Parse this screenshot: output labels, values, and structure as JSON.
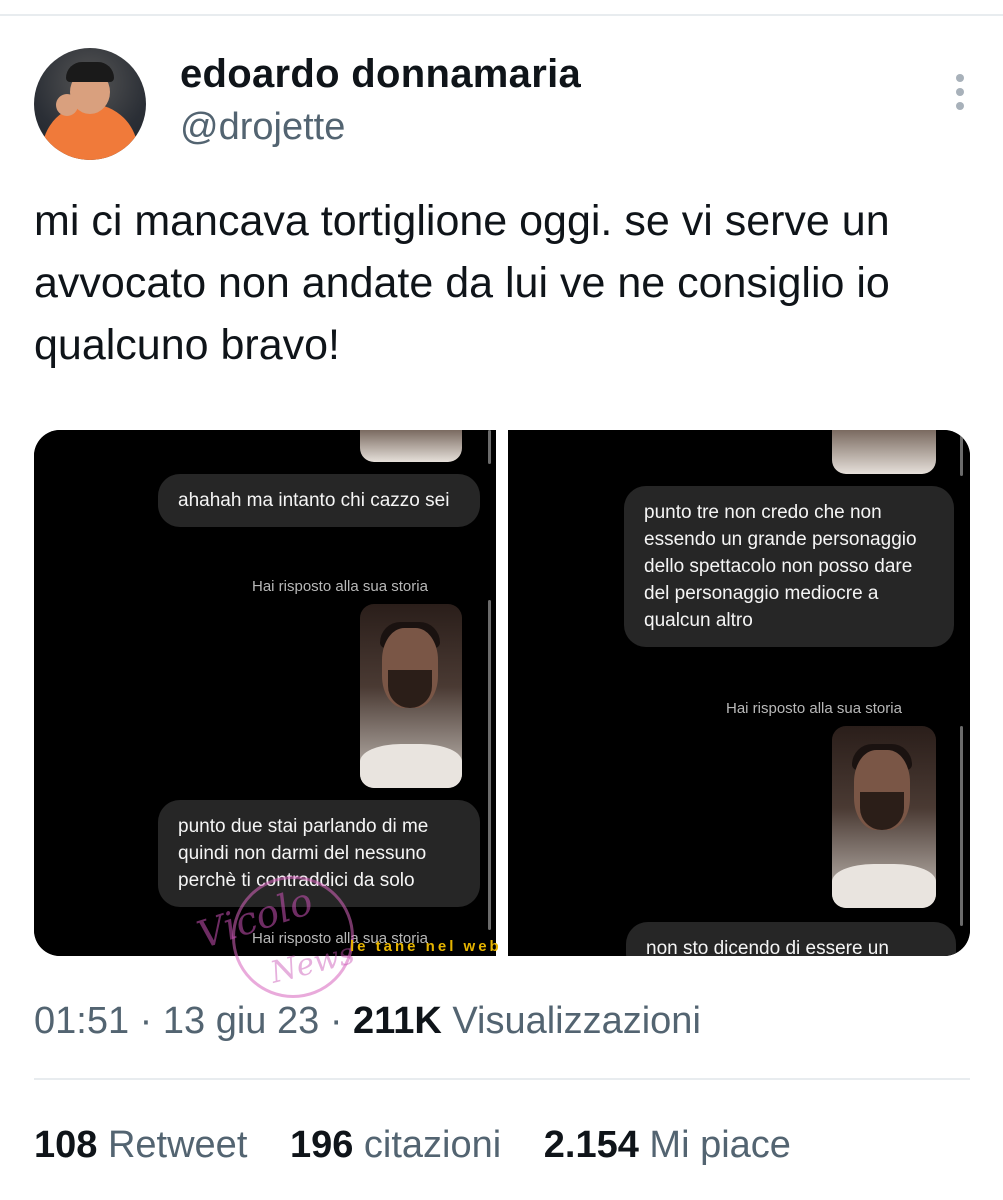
{
  "author": {
    "display_name": "edoardo donnamaria",
    "handle": "@drojette"
  },
  "tweet": {
    "text": "mi ci mancava tortiglione oggi. se vi serve un avvocato non andate da lui ve ne consiglio io qualcuno bravo!"
  },
  "media": {
    "left": {
      "bubble_1": "ahahah ma intanto chi cazzo sei",
      "reply_label_1": "Hai risposto alla sua storia",
      "bubble_2": "punto due stai parlando di me quindi non darmi del nessuno perchè ti contraddici da solo",
      "reply_label_2": "Hai risposto alla sua storia"
    },
    "right": {
      "bubble_1": "punto tre non credo che non essendo un grande personaggio dello spettacolo non posso dare del personaggio mediocre a qualcun altro",
      "reply_label_1": "Hai risposto alla sua storia",
      "bubble_2": "non sto dicendo di essere un"
    }
  },
  "watermark": {
    "line1": "Vicolo",
    "line2": "News",
    "site": "le tane nel web"
  },
  "meta": {
    "time": "01:51",
    "date": "13 giu 23",
    "views_count": "211K",
    "views_label": "Visualizzazioni"
  },
  "stats": {
    "retweets_count": "108",
    "retweets_label": "Retweet",
    "quotes_count": "196",
    "quotes_label": "citazioni",
    "likes_count": "2.154",
    "likes_label": "Mi piace"
  },
  "icons": {
    "more": "more-vertical-icon"
  },
  "colors": {
    "text_primary": "#0f1419",
    "text_secondary": "#536471",
    "bubble_bg": "#262626",
    "divider": "#e8ecef"
  }
}
